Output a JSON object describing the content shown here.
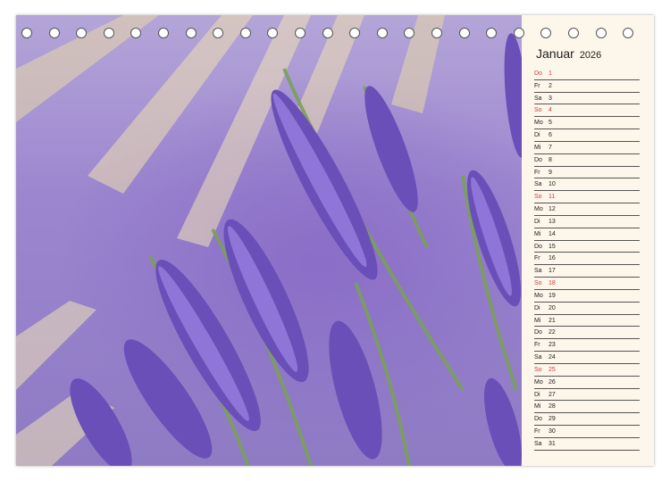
{
  "calendar": {
    "month": "Januar",
    "year": "2026",
    "days": [
      {
        "wd": "Do",
        "d": "1",
        "sun": true
      },
      {
        "wd": "Fr",
        "d": "2"
      },
      {
        "wd": "Sa",
        "d": "3"
      },
      {
        "wd": "So",
        "d": "4",
        "sun": true
      },
      {
        "wd": "Mo",
        "d": "5"
      },
      {
        "wd": "Di",
        "d": "6"
      },
      {
        "wd": "Mi",
        "d": "7"
      },
      {
        "wd": "Do",
        "d": "8"
      },
      {
        "wd": "Fr",
        "d": "9"
      },
      {
        "wd": "Sa",
        "d": "10"
      },
      {
        "wd": "So",
        "d": "11",
        "sun": true
      },
      {
        "wd": "Mo",
        "d": "12"
      },
      {
        "wd": "Di",
        "d": "13"
      },
      {
        "wd": "Mi",
        "d": "14"
      },
      {
        "wd": "Do",
        "d": "15"
      },
      {
        "wd": "Fr",
        "d": "16"
      },
      {
        "wd": "Sa",
        "d": "17"
      },
      {
        "wd": "So",
        "d": "18",
        "sun": true
      },
      {
        "wd": "Mo",
        "d": "19"
      },
      {
        "wd": "Di",
        "d": "20"
      },
      {
        "wd": "Mi",
        "d": "21"
      },
      {
        "wd": "Do",
        "d": "22"
      },
      {
        "wd": "Fr",
        "d": "23"
      },
      {
        "wd": "Sa",
        "d": "24"
      },
      {
        "wd": "So",
        "d": "25",
        "sun": true
      },
      {
        "wd": "Mo",
        "d": "26"
      },
      {
        "wd": "Di",
        "d": "27"
      },
      {
        "wd": "Mi",
        "d": "28"
      },
      {
        "wd": "Do",
        "d": "29"
      },
      {
        "wd": "Fr",
        "d": "30"
      },
      {
        "wd": "Sa",
        "d": "31"
      }
    ]
  },
  "colors": {
    "sunday": "#d23b3b",
    "panel": "#fdf6ea",
    "lavender": "#7a5cc4"
  }
}
